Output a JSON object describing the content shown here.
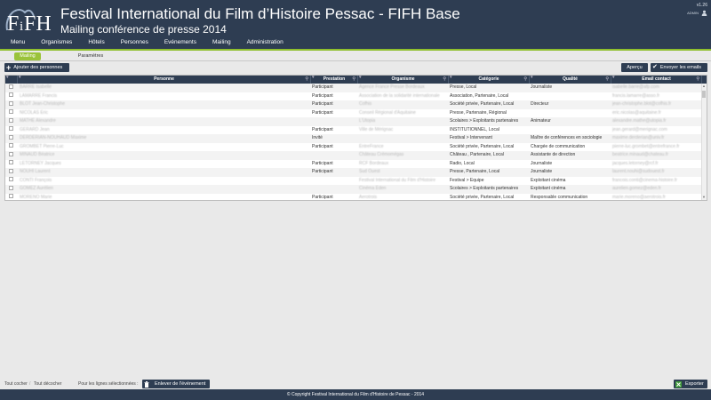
{
  "header": {
    "logo_text": "FiFHi",
    "title": "Festival International du Film d’Histoire Pessac - FIFH Base",
    "subtitle": "Mailing conférence de presse 2014",
    "version": "v1.26",
    "user": "ADMIN"
  },
  "menu": [
    "Menu",
    "Organismes",
    "Hôtels",
    "Personnes",
    "Evénements",
    "Mailing",
    "Administration"
  ],
  "subnav": {
    "active": "Mailing",
    "inactive": "Paramètres"
  },
  "toolbar": {
    "add_label": "Ajouter des personnes",
    "apercu_label": "Aperçu",
    "send_label": "Envoyer les emails"
  },
  "table": {
    "columns": [
      "Personne",
      "Prestation",
      "Organisme",
      "Catégorie",
      "Qualité",
      "Email contact"
    ],
    "rows": [
      {
        "personne": "BARRE Isabelle",
        "prestation": "Participant",
        "organisme": "Agence France Presse Bordeaux",
        "categorie": "Presse, Local",
        "qualite": "Journaliste",
        "email": "isabelle.barre@afp.com"
      },
      {
        "personne": "LAMARRE Francis",
        "prestation": "Participant",
        "organisme": "Association de la solidarité internationale",
        "categorie": "Association, Partenaire, Local",
        "qualite": "",
        "email": "francis.lamarre@asso.fr"
      },
      {
        "personne": "BLOT Jean-Christophe",
        "prestation": "Participant",
        "organisme": "Cofhis",
        "categorie": "Société privée, Partenaire, Local",
        "qualite": "Directeur",
        "email": "jean-christophe.blot@cofhis.fr"
      },
      {
        "personne": "NICOLAS Eric",
        "prestation": "Participant",
        "organisme": "Conseil Régional d'Aquitaine",
        "categorie": "Presse, Partenaire, Régional",
        "qualite": "",
        "email": "eric.nicolas@aquitaine.fr"
      },
      {
        "personne": "MATHE Alexandre",
        "prestation": "",
        "organisme": "L'Utopia",
        "categorie": "Scolaires > Exploitants partenaires",
        "qualite": "Animateur",
        "email": "alexandre.mathe@utopia.fr"
      },
      {
        "personne": "GERARD Jean",
        "prestation": "Participant",
        "organisme": "Ville de Mérignac",
        "categorie": "INSTITUTIONNEL, Local",
        "qualite": "",
        "email": "jean.gerard@merignac.com"
      },
      {
        "personne": "DERDERIAN-NOUHAUD Maxime",
        "prestation": "Invité",
        "organisme": "",
        "categorie": "Festival > Intervenant",
        "qualite": "Maître de conférences en sociologie",
        "email": "maxime.derderian@univ.fr"
      },
      {
        "personne": "GROMBET Pierre-Luc",
        "prestation": "Participant",
        "organisme": "EntreFrance",
        "categorie": "Société privée, Partenaire, Local",
        "qualite": "Chargée de communication",
        "email": "pierre-luc.grombet@entrefrance.fr"
      },
      {
        "personne": "MINAUD Béatrice",
        "prestation": "",
        "organisme": "Château Crémomégas",
        "categorie": "Château , Partenaire, Local",
        "qualite": "Assistante de direction",
        "email": "beatrice.minaud@chateau.fr"
      },
      {
        "personne": "LETORNEY Jacques",
        "prestation": "Participant",
        "organisme": "RCF Bordeaux",
        "categorie": "Radio, Local",
        "qualite": "Journaliste",
        "email": "jacques.letorney@rcf.fr"
      },
      {
        "personne": "NOUHI Laurent",
        "prestation": "Participant",
        "organisme": "Sud Ouest",
        "categorie": "Presse, Partenaire, Local",
        "qualite": "Journaliste",
        "email": "laurent.nouhi@sudouest.fr"
      },
      {
        "personne": "CONTI François",
        "prestation": "",
        "organisme": "Festival International du Film d'Histoire",
        "categorie": "Festival > Equipe",
        "qualite": "Exploitant cinéma",
        "email": "francois.conti@cinema-histoire.fr"
      },
      {
        "personne": "GOMEZ Aurélien",
        "prestation": "",
        "organisme": "Cinéma Eden",
        "categorie": "Scolaires > Exploitants partenaires",
        "qualite": "Exploitant cinéma",
        "email": "aurelien.gomez@eden.fr"
      },
      {
        "personne": "MORENO Marie",
        "prestation": "Participant",
        "organisme": "Aerotrois",
        "categorie": "Société privée, Partenaire, Local",
        "qualite": "Responsable communication",
        "email": "marie.moreno@aerotrois.fr"
      }
    ]
  },
  "bottom": {
    "check_all": "Tout cocher",
    "uncheck_all": "Tout décocher",
    "selected_label": "Pour les lignes sélectionnées :",
    "remove_label": "Enlever de l'événement",
    "export_label": "Exporter"
  },
  "footer": {
    "text": "© Copyright Festival International du Film d'Histoire de Pessac - 2014"
  },
  "colors": {
    "header_bg": "#2e3d52",
    "accent_green": "#8fbf2d"
  }
}
